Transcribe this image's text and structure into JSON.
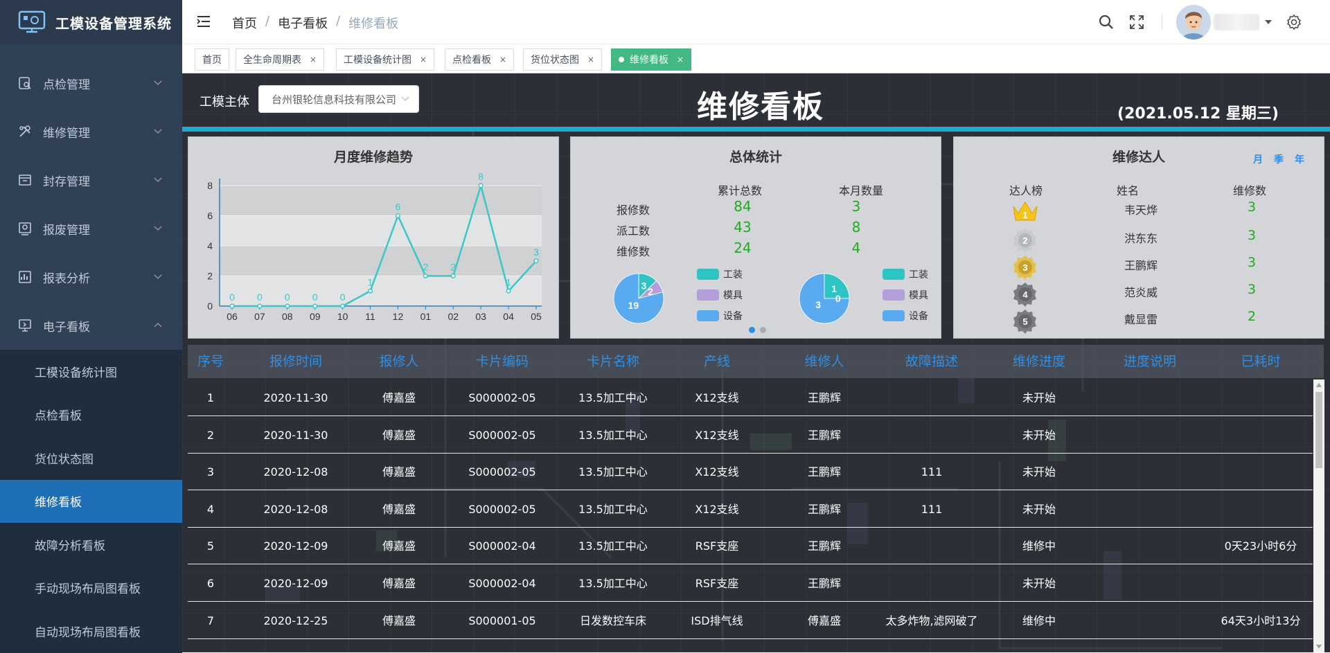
{
  "app": {
    "title": "工模设备管理系统"
  },
  "sidebar": {
    "items": [
      {
        "label": "点检管理",
        "icon": "checklist-icon"
      },
      {
        "label": "维修管理",
        "icon": "tools-icon"
      },
      {
        "label": "封存管理",
        "icon": "archive-icon"
      },
      {
        "label": "报废管理",
        "icon": "scrap-icon"
      },
      {
        "label": "报表分析",
        "icon": "report-icon"
      },
      {
        "label": "电子看板",
        "icon": "monitor-icon",
        "expanded": true
      }
    ],
    "sub_items": [
      {
        "label": "工模设备统计图"
      },
      {
        "label": "点检看板"
      },
      {
        "label": "货位状态图"
      },
      {
        "label": "维修看板",
        "active": true
      },
      {
        "label": "故障分析看板"
      },
      {
        "label": "手动现场布局图看板"
      },
      {
        "label": "自动现场布局图看板"
      }
    ]
  },
  "breadcrumb": {
    "home": "首页",
    "parent": "电子看板",
    "current": "维修看板"
  },
  "tags": [
    {
      "label": "首页",
      "closable": false
    },
    {
      "label": "全生命周期表",
      "closable": true
    },
    {
      "label": "工模设备统计图",
      "closable": true
    },
    {
      "label": "点检看板",
      "closable": true
    },
    {
      "label": "货位状态图",
      "closable": true
    },
    {
      "label": "维修看板",
      "closable": true,
      "active": true
    }
  ],
  "board": {
    "subject_label": "工模主体",
    "subject_value": "台州银轮信息科技有限公司",
    "title": "维修看板",
    "date": "(2021.05.12 星期三)"
  },
  "trend_panel": {
    "title": "月度维修趋势",
    "chart_data": {
      "type": "line",
      "categories": [
        "06",
        "07",
        "08",
        "09",
        "10",
        "11",
        "12",
        "01",
        "02",
        "03",
        "04",
        "05"
      ],
      "values": [
        0,
        0,
        0,
        0,
        0,
        1,
        6,
        2,
        2,
        8,
        1,
        3
      ],
      "yticks": [
        0,
        2,
        4,
        6,
        8
      ],
      "ylim": [
        0,
        8
      ],
      "color": "#3cc6c6",
      "data_labels": true
    }
  },
  "stats_panel": {
    "title": "总体统计",
    "col_total": "累计总数",
    "col_month": "本月数量",
    "rows": [
      {
        "label": "报修数",
        "total": "84",
        "month": "3"
      },
      {
        "label": "派工数",
        "total": "43",
        "month": "8"
      },
      {
        "label": "维修数",
        "total": "24",
        "month": "4"
      }
    ],
    "pies": [
      {
        "type": "pie",
        "slices": [
          {
            "name": "工装",
            "value": 3,
            "color": "#2ec4c4"
          },
          {
            "name": "模具",
            "value": 2,
            "color": "#b39ddb"
          },
          {
            "name": "设备",
            "value": 19,
            "color": "#5aaaf0"
          }
        ]
      },
      {
        "type": "pie",
        "slices": [
          {
            "name": "工装",
            "value": 1,
            "color": "#2ec4c4"
          },
          {
            "name": "模具",
            "value": 0,
            "color": "#b39ddb"
          },
          {
            "name": "设备",
            "value": 3,
            "color": "#5aaaf0"
          }
        ]
      }
    ],
    "legend": [
      "工装",
      "模具",
      "设备"
    ]
  },
  "ranking_panel": {
    "title": "维修达人",
    "periods": [
      "月",
      "季",
      "年"
    ],
    "col_rank": "达人榜",
    "col_name": "姓名",
    "col_count": "维修数",
    "rows": [
      {
        "rank": "1",
        "name": "韦天烨",
        "count": "3",
        "badge": "crown-gold"
      },
      {
        "rank": "2",
        "name": "洪东东",
        "count": "3",
        "badge": "silver"
      },
      {
        "rank": "3",
        "name": "王鹏辉",
        "count": "3",
        "badge": "bronze"
      },
      {
        "rank": "4",
        "name": "范炎威",
        "count": "3",
        "badge": "gray"
      },
      {
        "rank": "5",
        "name": "戴显雷",
        "count": "2",
        "badge": "gray"
      }
    ]
  },
  "table": {
    "headers": [
      "序号",
      "报修时间",
      "报修人",
      "卡片编码",
      "卡片名称",
      "产线",
      "维修人",
      "故障描述",
      "维修进度",
      "进度说明",
      "已耗时"
    ],
    "rows": [
      [
        "1",
        "2020-11-30",
        "傅嘉盛",
        "S000002-05",
        "13.5加工中心",
        "X12支线",
        "王鹏辉",
        "",
        "未开始",
        "",
        ""
      ],
      [
        "2",
        "2020-11-30",
        "傅嘉盛",
        "S000002-05",
        "13.5加工中心",
        "X12支线",
        "王鹏辉",
        "",
        "未开始",
        "",
        ""
      ],
      [
        "3",
        "2020-12-08",
        "傅嘉盛",
        "S000002-05",
        "13.5加工中心",
        "X12支线",
        "王鹏辉",
        "111",
        "未开始",
        "",
        ""
      ],
      [
        "4",
        "2020-12-08",
        "傅嘉盛",
        "S000002-05",
        "13.5加工中心",
        "X12支线",
        "王鹏辉",
        "111",
        "未开始",
        "",
        ""
      ],
      [
        "5",
        "2020-12-09",
        "傅嘉盛",
        "S000002-04",
        "13.5加工中心",
        "RSF支座",
        "王鹏辉",
        "",
        "维修中",
        "",
        "0天23小时6分"
      ],
      [
        "6",
        "2020-12-09",
        "傅嘉盛",
        "S000002-04",
        "13.5加工中心",
        "RSF支座",
        "王鹏辉",
        "",
        "未开始",
        "",
        ""
      ],
      [
        "7",
        "2020-12-25",
        "傅嘉盛",
        "S000001-05",
        "日发数控车床",
        "ISD排气线",
        "傅嘉盛",
        "太多炸物,滤网破了",
        "维修中",
        "",
        "64天3小时13分"
      ]
    ]
  },
  "colors": {
    "sidebar": "#304156",
    "active_menu": "#1f6fb6",
    "accent_cyan": "#1ea9d8",
    "tag_active": "#42b983",
    "number_green": "#22aa22",
    "header_blue": "#2f8fe6"
  }
}
